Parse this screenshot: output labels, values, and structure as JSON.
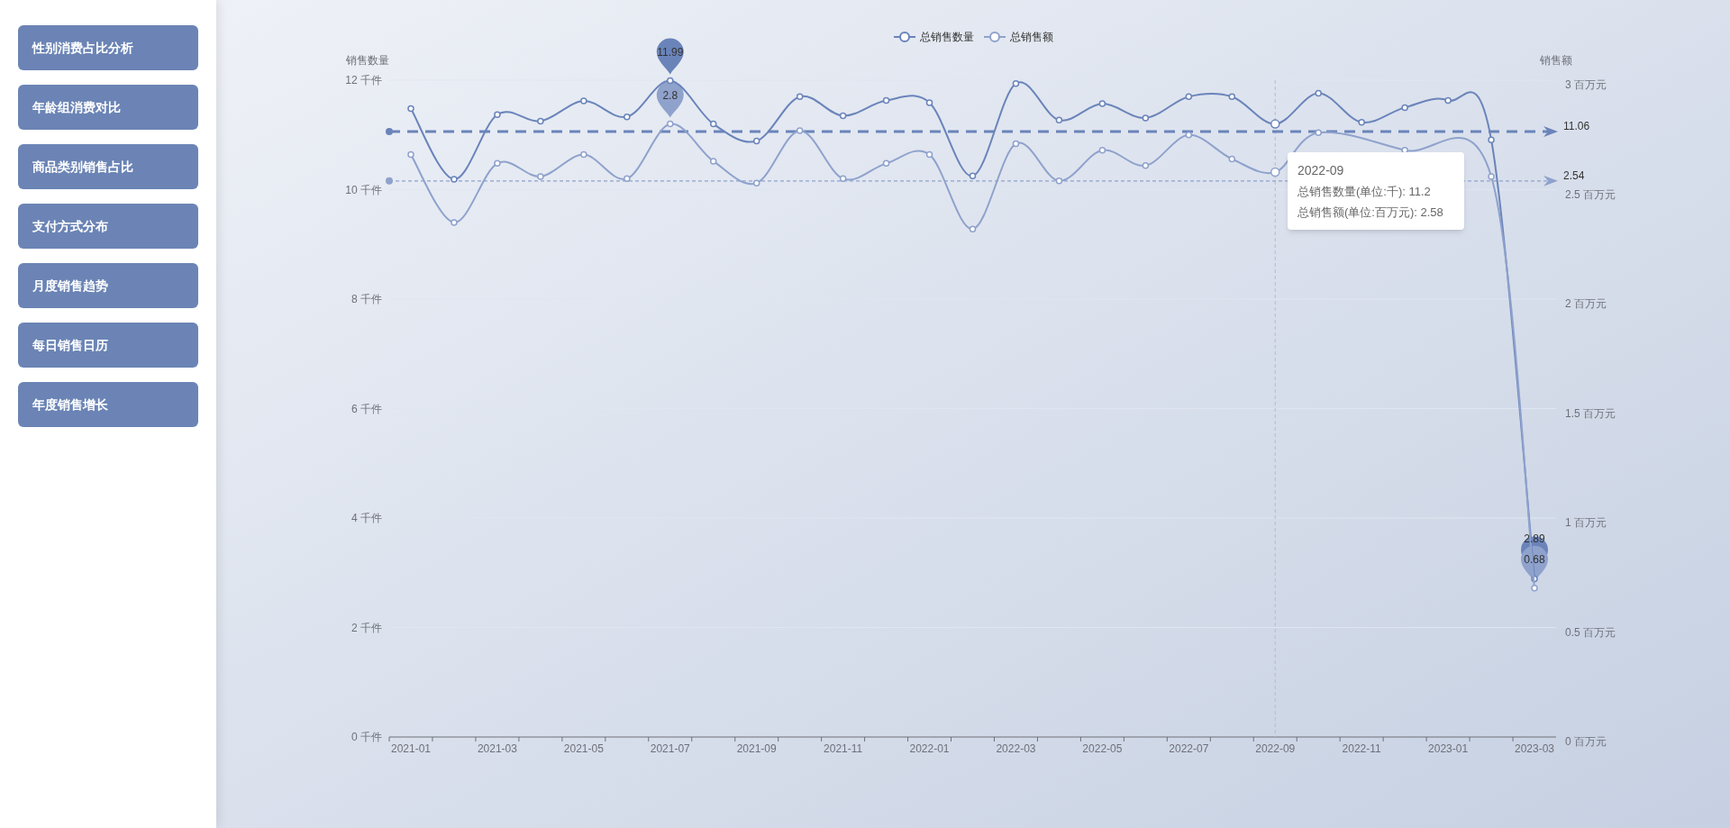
{
  "sidebar": {
    "items": [
      "性别消费占比分析",
      "年龄组消费对比",
      "商品类别销售占比",
      "支付方式分布",
      "月度销售趋势",
      "每日销售日历",
      "年度销售增长"
    ]
  },
  "main": {
    "chart_data": {
      "type": "line",
      "categories": [
        "2021-01",
        null,
        "2021-03",
        null,
        "2021-05",
        null,
        "2021-07",
        null,
        "2021-09",
        null,
        "2021-11",
        null,
        "2022-01",
        null,
        "2022-03",
        null,
        "2022-05",
        null,
        "2022-07",
        null,
        "2022-09",
        null,
        "2022-11",
        null,
        "2023-01",
        null,
        "2023-03"
      ],
      "ylabel": "销售数量",
      "y2label": "销售额",
      "ylim": [
        0,
        12
      ],
      "y2lim": [
        0,
        3
      ],
      "yticks": [
        {
          "value": 0,
          "label": "0 千件"
        },
        {
          "value": 2,
          "label": "2 千件"
        },
        {
          "value": 4,
          "label": "4 千件"
        },
        {
          "value": 6,
          "label": "6 千件"
        },
        {
          "value": 8,
          "label": "8 千件"
        },
        {
          "value": 10,
          "label": "10 千件"
        },
        {
          "value": 12,
          "label": "12 千件"
        }
      ],
      "y2ticks": [
        {
          "value": 0,
          "label": "0 百万元"
        },
        {
          "value": 0.5,
          "label": "0.5 百万元"
        },
        {
          "value": 1,
          "label": "1 百万元"
        },
        {
          "value": 1.5,
          "label": "1.5 百万元"
        },
        {
          "value": 2,
          "label": "2 百万元"
        },
        {
          "value": 2.5,
          "label": "2.5 百万元"
        },
        {
          "value": 3,
          "label": "3 百万元"
        }
      ],
      "grid": true,
      "legend": true,
      "series": [
        {
          "name": "总销售数量",
          "color": "#6a84ba",
          "marker": "circle",
          "values": [
            11.48,
            10.19,
            11.37,
            11.25,
            11.62,
            11.33,
            11.99,
            11.2,
            10.89,
            11.7,
            11.35,
            11.63,
            11.59,
            10.25,
            11.94,
            11.27,
            11.57,
            11.31,
            11.7,
            11.7,
            11.2,
            11.76,
            11.23,
            11.5,
            11.63,
            10.91,
            2.89
          ]
        },
        {
          "name": "总销售额",
          "color": "#8fa2cc",
          "marker": "circle",
          "axis": "y2",
          "values": [
            2.66,
            2.35,
            2.62,
            2.56,
            2.66,
            2.55,
            2.8,
            2.63,
            2.53,
            2.77,
            2.55,
            2.62,
            2.66,
            2.32,
            2.71,
            2.54,
            2.68,
            2.61,
            2.75,
            2.64,
            2.58,
            2.76,
            null,
            2.68,
            null,
            2.56,
            0.68
          ]
        }
      ],
      "annotations": [
        "11.99",
        "2.8",
        "2.89",
        "0.68"
      ],
      "ref_lines": [
        {
          "axis": "y",
          "value": 11.06,
          "label": "11.06"
        },
        {
          "axis": "y2",
          "value": 2.54,
          "label": "2.54"
        },
        {
          "axis": "x",
          "value": "2022-09"
        }
      ]
    },
    "tooltip": {
      "title": "2022-09",
      "lines": [
        "总销售数量(单位:千): 11.2",
        "总销售额(单位:百万元): 2.58"
      ]
    }
  }
}
